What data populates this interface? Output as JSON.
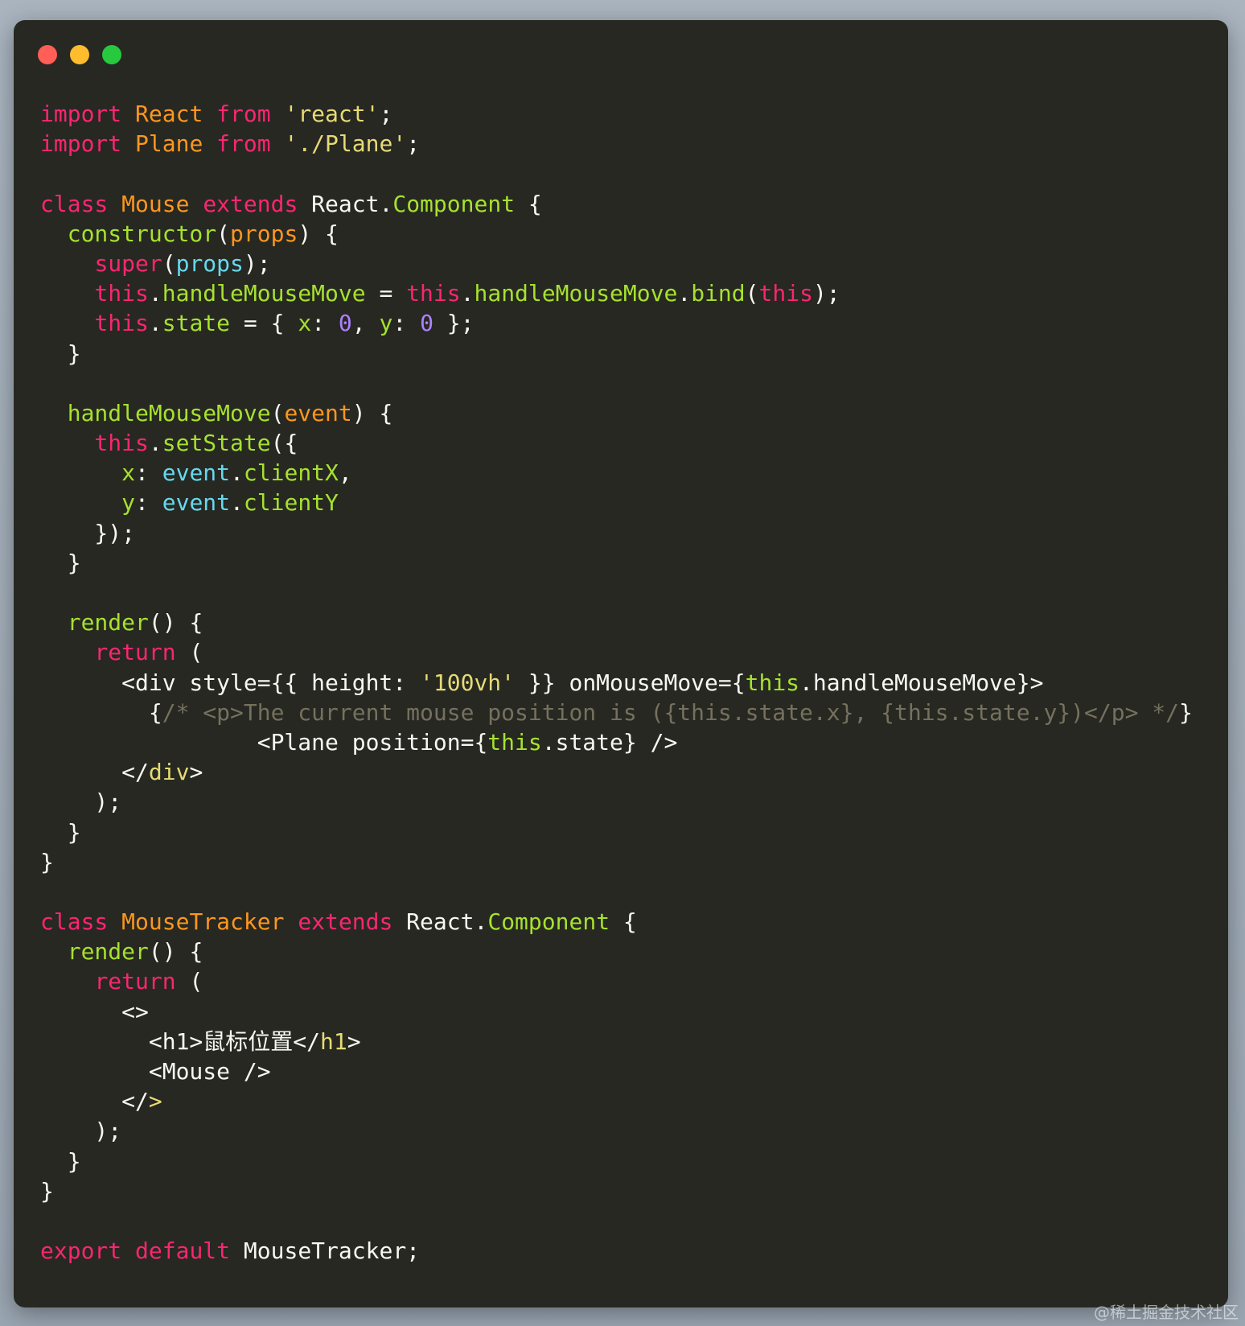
{
  "window": {
    "traffic_lights": [
      "close",
      "minimize",
      "zoom"
    ],
    "colors": {
      "background": "#272822",
      "close": "#ff5f56",
      "minimize": "#ffbd2e",
      "zoom": "#27c93f",
      "keyword": "#f92672",
      "class_name": "#fd971f",
      "string": "#e6db74",
      "function": "#a6e22e",
      "number": "#ae81ff",
      "property": "#66d9ef",
      "comment": "#75715e",
      "text": "#f8f8f2"
    }
  },
  "code_lines": [
    [
      [
        "kw",
        "import"
      ],
      [
        "plain",
        " "
      ],
      [
        "cls",
        "React"
      ],
      [
        "plain",
        " "
      ],
      [
        "kw",
        "from"
      ],
      [
        "plain",
        " "
      ],
      [
        "str",
        "'react'"
      ],
      [
        "plain",
        ";"
      ]
    ],
    [
      [
        "kw",
        "import"
      ],
      [
        "plain",
        " "
      ],
      [
        "cls",
        "Plane"
      ],
      [
        "plain",
        " "
      ],
      [
        "kw",
        "from"
      ],
      [
        "plain",
        " "
      ],
      [
        "str",
        "'./Plane'"
      ],
      [
        "plain",
        ";"
      ]
    ],
    [],
    [
      [
        "kw",
        "class"
      ],
      [
        "plain",
        " "
      ],
      [
        "cls",
        "Mouse"
      ],
      [
        "plain",
        " "
      ],
      [
        "kw",
        "extends"
      ],
      [
        "plain",
        " React."
      ],
      [
        "fn",
        "Component"
      ],
      [
        "plain",
        " {"
      ]
    ],
    [
      [
        "plain",
        "  "
      ],
      [
        "fn",
        "constructor"
      ],
      [
        "plain",
        "("
      ],
      [
        "param",
        "props"
      ],
      [
        "plain",
        ") {"
      ]
    ],
    [
      [
        "plain",
        "    "
      ],
      [
        "kw",
        "super"
      ],
      [
        "plain",
        "("
      ],
      [
        "prop",
        "props"
      ],
      [
        "plain",
        ");"
      ]
    ],
    [
      [
        "plain",
        "    "
      ],
      [
        "kw",
        "this"
      ],
      [
        "plain",
        "."
      ],
      [
        "fn",
        "handleMouseMove"
      ],
      [
        "plain",
        " = "
      ],
      [
        "kw",
        "this"
      ],
      [
        "plain",
        "."
      ],
      [
        "fn",
        "handleMouseMove"
      ],
      [
        "plain",
        "."
      ],
      [
        "fn",
        "bind"
      ],
      [
        "plain",
        "("
      ],
      [
        "kw",
        "this"
      ],
      [
        "plain",
        ");"
      ]
    ],
    [
      [
        "plain",
        "    "
      ],
      [
        "kw",
        "this"
      ],
      [
        "plain",
        "."
      ],
      [
        "fn",
        "state"
      ],
      [
        "plain",
        " = { "
      ],
      [
        "fn",
        "x"
      ],
      [
        "plain",
        ": "
      ],
      [
        "num",
        "0"
      ],
      [
        "plain",
        ", "
      ],
      [
        "fn",
        "y"
      ],
      [
        "plain",
        ": "
      ],
      [
        "num",
        "0"
      ],
      [
        "plain",
        " };"
      ]
    ],
    [
      [
        "plain",
        "  }"
      ]
    ],
    [],
    [
      [
        "plain",
        "  "
      ],
      [
        "fn",
        "handleMouseMove"
      ],
      [
        "plain",
        "("
      ],
      [
        "param",
        "event"
      ],
      [
        "plain",
        ") {"
      ]
    ],
    [
      [
        "plain",
        "    "
      ],
      [
        "kw",
        "this"
      ],
      [
        "plain",
        "."
      ],
      [
        "fn",
        "setState"
      ],
      [
        "plain",
        "({"
      ]
    ],
    [
      [
        "plain",
        "      "
      ],
      [
        "fn",
        "x"
      ],
      [
        "plain",
        ": "
      ],
      [
        "prop",
        "event"
      ],
      [
        "plain",
        "."
      ],
      [
        "fn",
        "clientX"
      ],
      [
        "plain",
        ","
      ]
    ],
    [
      [
        "plain",
        "      "
      ],
      [
        "fn",
        "y"
      ],
      [
        "plain",
        ": "
      ],
      [
        "prop",
        "event"
      ],
      [
        "plain",
        "."
      ],
      [
        "fn",
        "clientY"
      ]
    ],
    [
      [
        "plain",
        "    });"
      ]
    ],
    [
      [
        "plain",
        "  }"
      ]
    ],
    [],
    [
      [
        "plain",
        "  "
      ],
      [
        "fn",
        "render"
      ],
      [
        "plain",
        "() {"
      ]
    ],
    [
      [
        "plain",
        "    "
      ],
      [
        "kw",
        "return"
      ],
      [
        "plain",
        " ("
      ]
    ],
    [
      [
        "plain",
        "      <div style={{ height: "
      ],
      [
        "str",
        "'100vh'"
      ],
      [
        "plain",
        " }} onMouseMove={"
      ],
      [
        "fn",
        "this"
      ],
      [
        "plain",
        ".handleMouseMove}>"
      ]
    ],
    [
      [
        "plain",
        "        {"
      ],
      [
        "cmt",
        "/* <p>The current mouse position is ({this.state.x}, {this.state.y})</p> */"
      ],
      [
        "plain",
        "}"
      ]
    ],
    [
      [
        "plain",
        "                <Plane position={"
      ],
      [
        "fn",
        "this"
      ],
      [
        "plain",
        ".state} />"
      ]
    ],
    [
      [
        "plain",
        "      </"
      ],
      [
        "str",
        "div"
      ],
      [
        "plain",
        ">"
      ]
    ],
    [
      [
        "plain",
        "    );"
      ]
    ],
    [
      [
        "plain",
        "  }"
      ]
    ],
    [
      [
        "plain",
        "}"
      ]
    ],
    [],
    [
      [
        "kw",
        "class"
      ],
      [
        "plain",
        " "
      ],
      [
        "cls",
        "MouseTracker"
      ],
      [
        "plain",
        " "
      ],
      [
        "kw",
        "extends"
      ],
      [
        "plain",
        " React."
      ],
      [
        "fn",
        "Component"
      ],
      [
        "plain",
        " {"
      ]
    ],
    [
      [
        "plain",
        "  "
      ],
      [
        "fn",
        "render"
      ],
      [
        "plain",
        "() {"
      ]
    ],
    [
      [
        "plain",
        "    "
      ],
      [
        "kw",
        "return"
      ],
      [
        "plain",
        " ("
      ]
    ],
    [
      [
        "plain",
        "      <>"
      ]
    ],
    [
      [
        "plain",
        "        <h1>鼠标位置</"
      ],
      [
        "str",
        "h1"
      ],
      [
        "plain",
        ">"
      ]
    ],
    [
      [
        "plain",
        "        <Mouse />"
      ]
    ],
    [
      [
        "plain",
        "      </"
      ],
      [
        "str",
        ">"
      ]
    ],
    [
      [
        "plain",
        "    );"
      ]
    ],
    [
      [
        "plain",
        "  }"
      ]
    ],
    [
      [
        "plain",
        "}"
      ]
    ],
    [],
    [
      [
        "kw",
        "export"
      ],
      [
        "plain",
        " "
      ],
      [
        "kw",
        "default"
      ],
      [
        "plain",
        " MouseTracker;"
      ]
    ]
  ],
  "watermark": "@稀土掘金技术社区"
}
